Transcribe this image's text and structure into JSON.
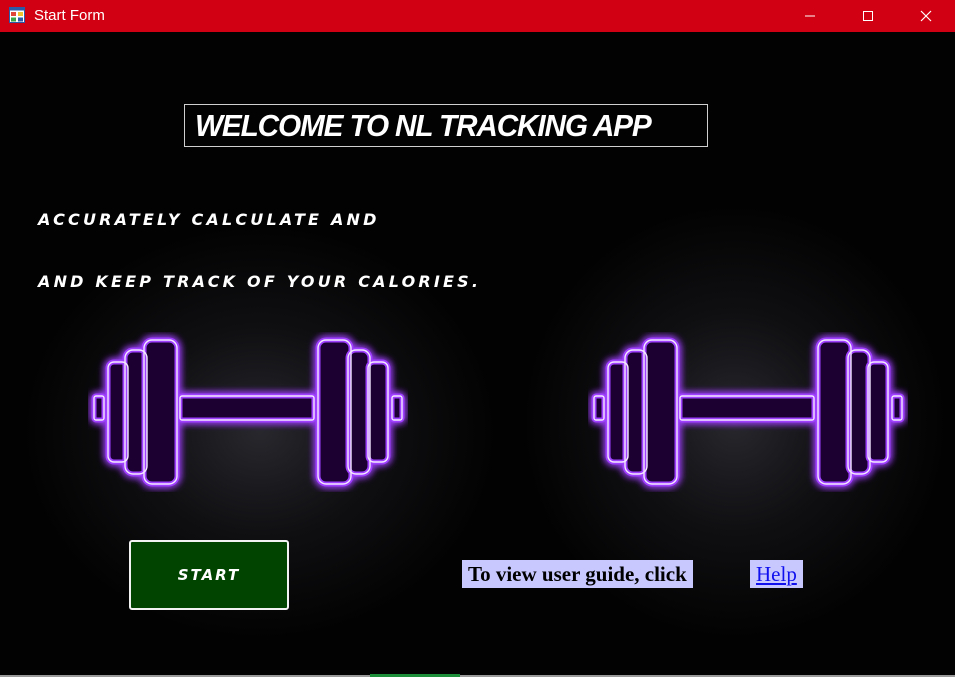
{
  "window": {
    "title": "Start Form",
    "titlebar_color": "#d10012",
    "app_icon": "form-icon",
    "controls": [
      "minimize-icon",
      "maximize-icon",
      "close-icon"
    ]
  },
  "main": {
    "welcome": "WELCOME TO NL TRACKING APP",
    "tagline_line1": "ACCURATELY CALCULATE AND",
    "tagline_line2": "AND KEEP TRACK OF YOUR CALORIES.",
    "images": [
      "dumbbell-icon",
      "dumbbell-icon"
    ],
    "neon_color": "#9a33ff",
    "start_button": "START",
    "start_button_color": "#004400",
    "guide_text": "To view user guide, click",
    "help_link": "Help",
    "label_background": "#c8c8ff"
  }
}
